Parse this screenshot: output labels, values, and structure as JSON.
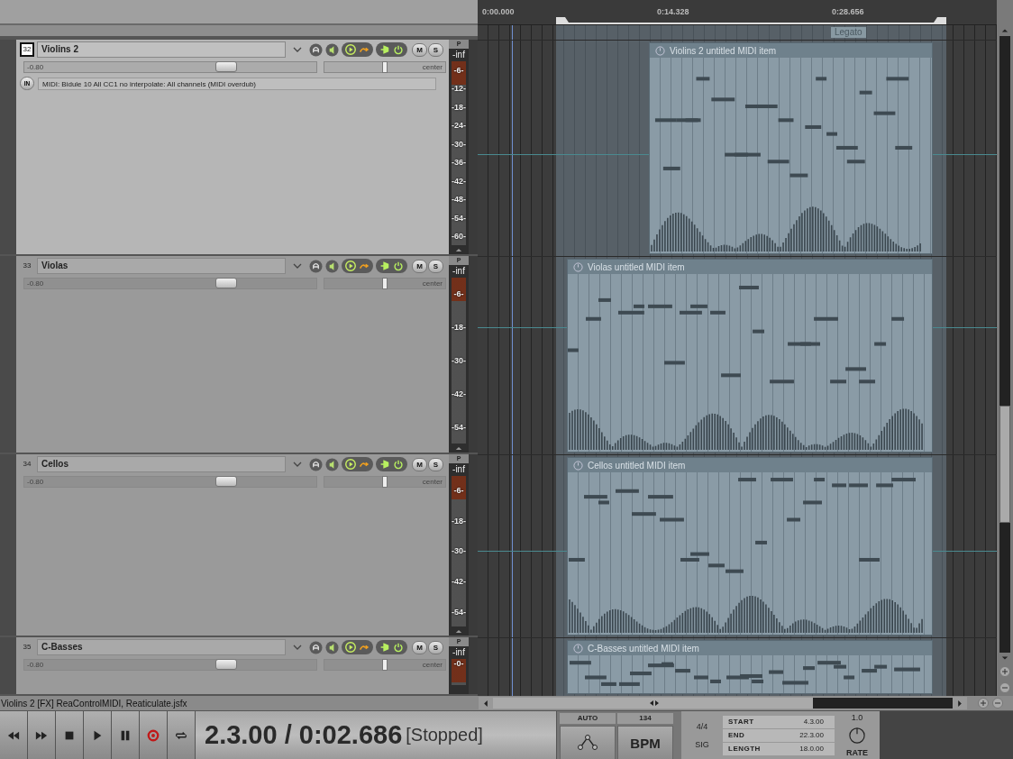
{
  "tracks": [
    {
      "number": "32",
      "name": "Violins 2",
      "selected": true,
      "volume": {
        "value": "-0.80",
        "level": 0.69
      },
      "pan": {
        "value": "center",
        "level": 0.5
      },
      "buttons": [
        "M",
        "S"
      ],
      "input": {
        "button": "IN",
        "value": "MIDI: Bidule 10 All  CC1 no interpolate: All channels (MIDI overdub)"
      },
      "meter": {
        "label": "P",
        "peak": "-inf",
        "ticks": [
          "-6-",
          "-12-",
          "-18-",
          "-24-",
          "-30-",
          "-36-",
          "-42-",
          "-48-",
          "-54-",
          "-60-"
        ]
      },
      "item": {
        "title": "Violins 2 untitled MIDI item"
      }
    },
    {
      "number": "33",
      "name": "Violas",
      "selected": false,
      "volume": {
        "value": "-0.80",
        "level": 0.69
      },
      "pan": {
        "value": "center",
        "level": 0.5
      },
      "buttons": [
        "M",
        "S"
      ],
      "meter": {
        "label": "P",
        "peak": "-inf",
        "ticks": [
          "-6-",
          "-18-",
          "-30-",
          "-42-",
          "-54-"
        ]
      },
      "item": {
        "title": "Violas untitled MIDI item"
      }
    },
    {
      "number": "34",
      "name": "Cellos",
      "selected": false,
      "volume": {
        "value": "-0.80",
        "level": 0.69
      },
      "pan": {
        "value": "center",
        "level": 0.5
      },
      "buttons": [
        "M",
        "S"
      ],
      "meter": {
        "label": "P",
        "peak": "-inf",
        "ticks": [
          "-6-",
          "-18-",
          "-30-",
          "-42-",
          "-54-"
        ]
      },
      "item": {
        "title": "Cellos untitled MIDI item"
      }
    },
    {
      "number": "35",
      "name": "C-Basses",
      "selected": false,
      "volume": {
        "value": "-0.80",
        "level": 0.69
      },
      "pan": {
        "value": "center",
        "level": 0.5
      },
      "buttons": [
        "M",
        "S"
      ],
      "meter": {
        "label": "P",
        "peak": "-inf",
        "ticks": [
          "-0-"
        ]
      },
      "item": {
        "title": "C-Basses untitled MIDI item"
      }
    }
  ],
  "arrange": {
    "ruler": [
      "0:00.000",
      "0:14.328",
      "0:28.656"
    ],
    "previous_item_label": "Legato"
  },
  "status_bar": "Violins 2 [FX] ReaControlMIDI, Reaticulate.jsfx",
  "transport": {
    "position": "2.3.00 / 0:02.686",
    "state": "[Stopped]",
    "auto": "AUTO",
    "tempo": "134",
    "bpm": "BPM",
    "signature": "4/4",
    "sig": "SIG",
    "loop": [
      {
        "label": "START",
        "value": "4.3.00"
      },
      {
        "label": "END",
        "value": "22.3.00"
      },
      {
        "label": "LENGTH",
        "value": "18.0.00"
      }
    ],
    "rate": {
      "value": "1.0",
      "label": "RATE"
    }
  }
}
